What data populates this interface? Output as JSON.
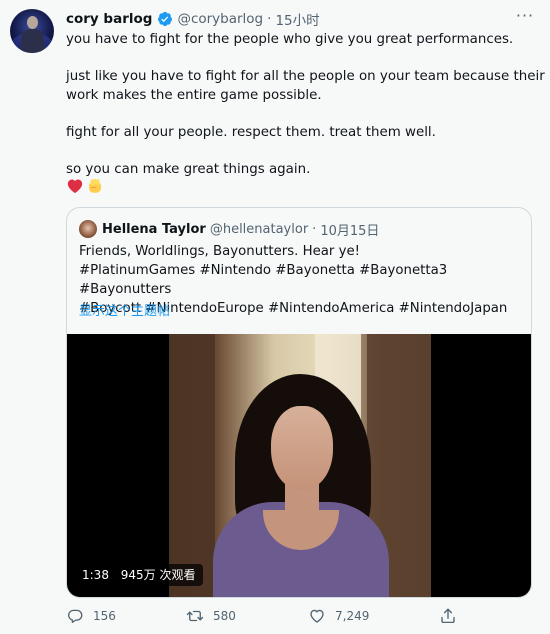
{
  "tweet": {
    "author": {
      "name": "cory barlog",
      "handle": "@corybarlog",
      "time": "15小时",
      "verified": true
    },
    "paragraphs": [
      "you have to fight for the people who give you great performances.",
      "just like you have to fight for all the people on your team because their work makes the entire game possible.",
      "fight for all your people. respect them.  treat them well.",
      "so you can make great things again."
    ],
    "emojis": [
      "red-heart-emoji",
      "raised-fist-emoji"
    ],
    "more_icon": "ellipsis-icon"
  },
  "quote": {
    "author": {
      "name": "Hellena Taylor",
      "handle": "@hellenataylor",
      "time": "10月15日"
    },
    "lines": [
      "Friends, Worldlings, Bayonutters. Hear ye!",
      "#PlatinumGames #Nintendo #Bayonetta #Bayonetta3 #Bayonutters",
      "#Boycott #NintendoEurope #NintendoAmerica #NintendoJapan"
    ],
    "show_thread": "显示这个主题帖",
    "video": {
      "duration": "1:38",
      "views": "945万 次观看"
    }
  },
  "actions": {
    "reply_count": "156",
    "retweet_count": "580",
    "like_count": "7,249",
    "icons": [
      "reply-icon",
      "retweet-icon",
      "like-icon",
      "share-icon"
    ]
  },
  "colors": {
    "background": "#f7f9f9",
    "text": "#0f1419",
    "secondary": "#536471",
    "link": "#1d9bf0",
    "verified": "#1d9bf0",
    "border": "#cfd9de"
  }
}
